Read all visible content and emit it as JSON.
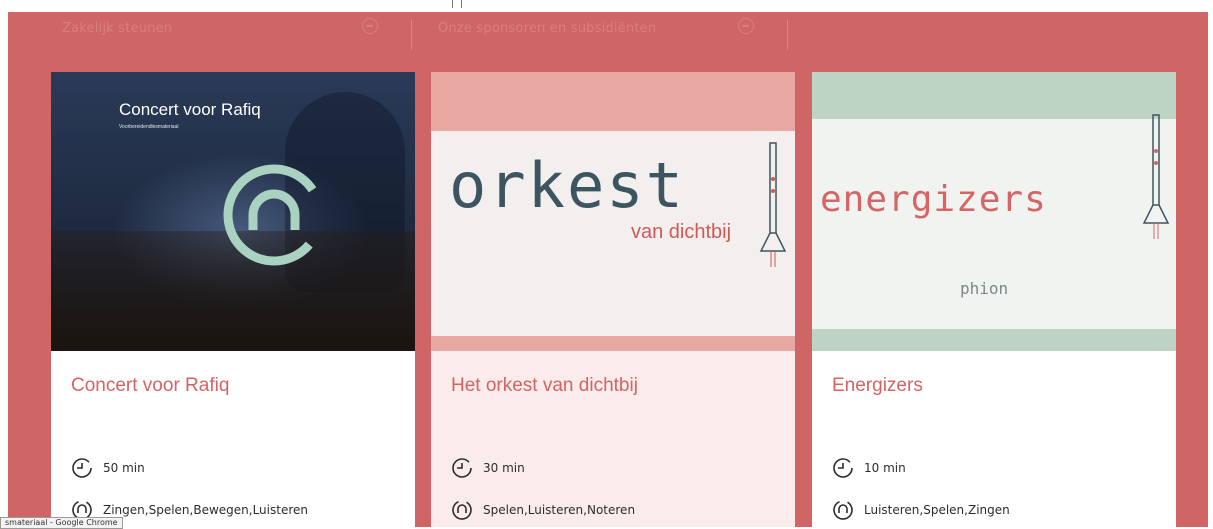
{
  "nav_links": [
    {
      "label": "Zakelijk steunen"
    },
    {
      "label": "Onze sponsoren en subsidiënten"
    }
  ],
  "cards": [
    {
      "media_title": "Concert voor Rafiq",
      "media_subtitle": "Voorbereidendlesmateriaal",
      "title": "Concert voor Rafiq",
      "duration": "50 min",
      "activities": "Zingen,Spelen,Bewegen,Luisteren"
    },
    {
      "media_word": "orkest",
      "media_subtitle": "van dichtbij",
      "title": "Het orkest van dichtbij",
      "duration": "30 min",
      "activities": "Spelen,Luisteren,Noteren"
    },
    {
      "media_word": "energizers",
      "media_brand": "phion",
      "title": "Energizers",
      "duration": "10 min",
      "activities": "Luisteren,Spelen,Zingen"
    }
  ],
  "status_tooltip": "smateriaal - Google Chrome",
  "colors": {
    "background": "#cf6565",
    "title_accent": "#d56363",
    "card2_body": "#fbecec",
    "orkest_dark": "#3d5561",
    "energizers_green": "#bdd3c4"
  },
  "icons": {
    "duration": "timer-icon",
    "activities": "cycle-icon",
    "nav_arrow": "arrow-circle-icon"
  }
}
